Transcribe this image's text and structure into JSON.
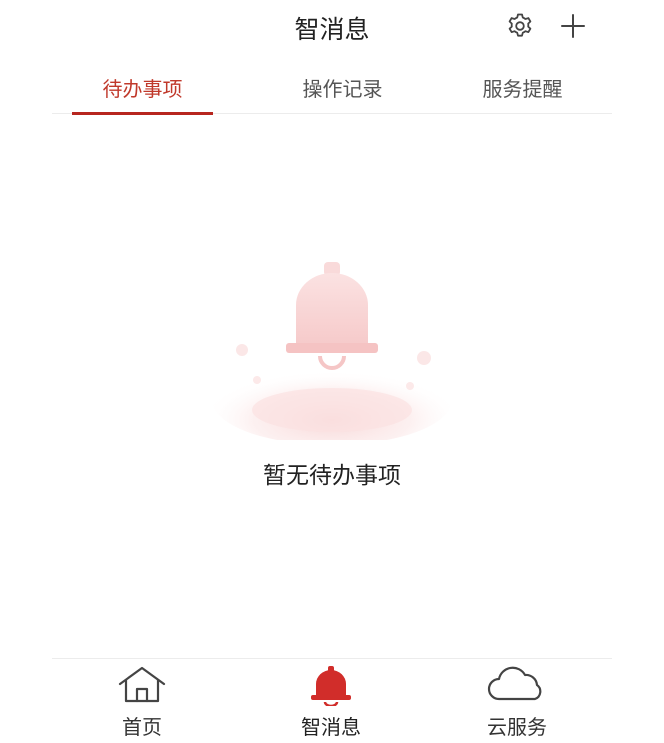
{
  "header": {
    "title": "智消息",
    "settings_icon": "gear-icon",
    "add_icon": "plus-icon"
  },
  "tabs": [
    {
      "label": "待办事项",
      "active": true
    },
    {
      "label": "操作记录",
      "active": false
    },
    {
      "label": "服务提醒",
      "active": false
    }
  ],
  "empty_state": {
    "message": "暂无待办事项",
    "icon": "bell-icon"
  },
  "bottom_nav": [
    {
      "label": "首页",
      "icon": "home-icon",
      "active": false
    },
    {
      "label": "智消息",
      "icon": "bell-icon",
      "active": true
    },
    {
      "label": "云服务",
      "icon": "cloud-icon",
      "active": false
    }
  ],
  "colors": {
    "accent": "#b7261f",
    "text": "#222222",
    "muted": "#555555",
    "divider": "#ececec"
  }
}
